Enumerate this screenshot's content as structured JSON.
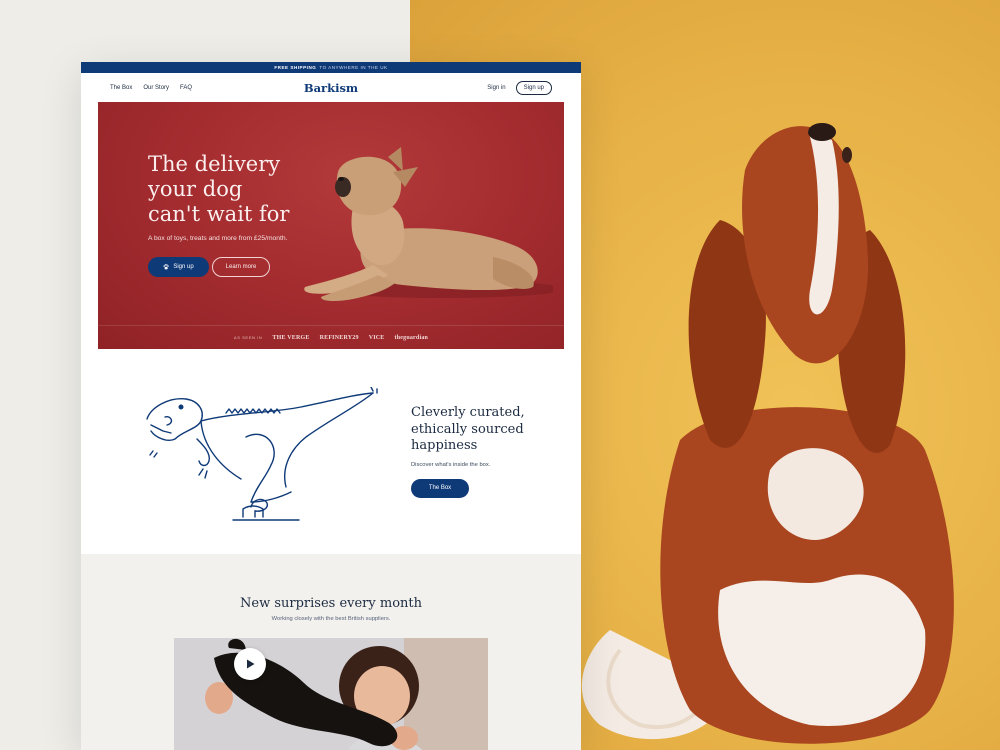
{
  "promo": {
    "strong": "FREE SHIPPING",
    "rest": "TO ANYWHERE IN THE UK"
  },
  "nav": {
    "links": [
      "The Box",
      "Our Story",
      "FAQ"
    ],
    "brand": "Barkism",
    "sign_in": "Sign in",
    "sign_up": "Sign up"
  },
  "hero": {
    "title": "The delivery your dog can't wait for",
    "subtitle": "A box of toys, treats and more from £25/month.",
    "primary_cta": "Sign up",
    "secondary_cta": "Learn more",
    "press_label": "AS SEEN IN",
    "press_logos": [
      "THE VERGE",
      "REFINERY29",
      "VICE",
      "theguardian"
    ]
  },
  "curated": {
    "title": "Cleverly curated, ethically sourced happiness",
    "subtitle": "Discover what's inside the box.",
    "cta": "The Box"
  },
  "surprises": {
    "title": "New surprises every month",
    "subtitle": "Working closely with the best British suppliers."
  },
  "colors": {
    "brand": "#0f3a78",
    "hero_red": "#a52d30",
    "backdrop_yellow": "#e7b247",
    "light_bg": "#f3f1ed"
  },
  "icons": [
    "paw-icon",
    "play-icon"
  ]
}
